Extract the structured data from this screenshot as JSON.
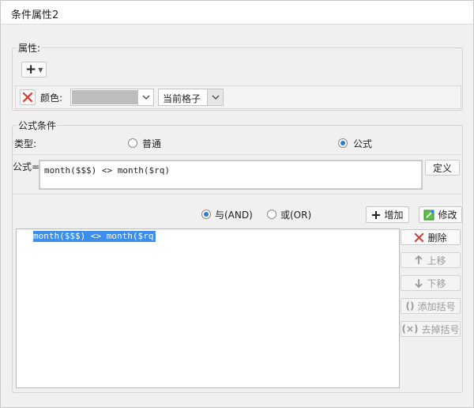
{
  "window": {
    "title": "条件属性2"
  },
  "properties": {
    "group_label": "属性:",
    "add_symbol": "+",
    "color_label": "颜色:",
    "color_value": "#bdbdbd",
    "scope_value": "当前格子"
  },
  "formula_condition": {
    "group_label": "公式条件",
    "type_label": "类型:",
    "option_normal": "普通",
    "option_formula": "公式",
    "formula_label": "公式=",
    "formula_value": "month($$$) <> month($rq)",
    "define_button": "定义"
  },
  "conditions": {
    "and_label": "与(AND)",
    "or_label": "或(OR)",
    "add_button": "增加",
    "modify_button": "修改",
    "delete_button": "删除",
    "move_up_button": "上移",
    "move_down_button": "下移",
    "add_bracket_button": "添加括号",
    "remove_bracket_button": "去掉括号",
    "items": [
      "month($$$) <> month($rq)"
    ]
  },
  "colors": {
    "accent": "#2f7ad8",
    "selection": "#3d8ee8",
    "delete_red": "#e03a2f"
  }
}
